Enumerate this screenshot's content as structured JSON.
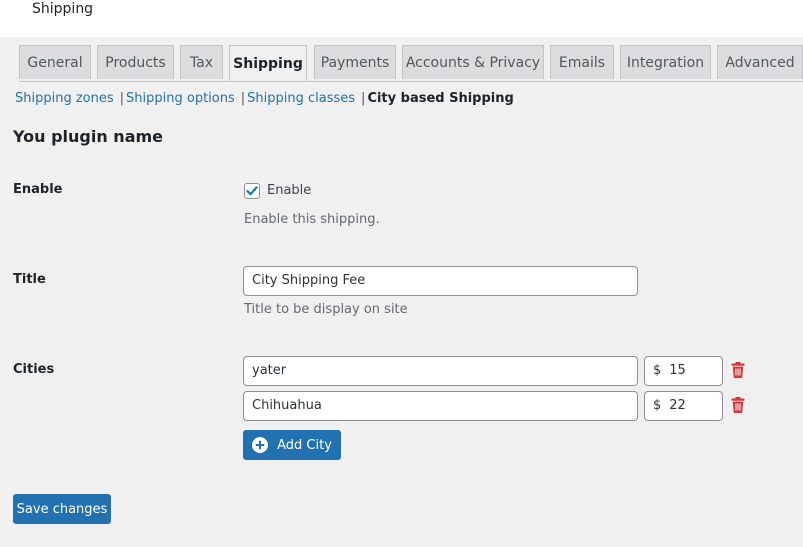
{
  "page": {
    "title": "Shipping"
  },
  "tabs": [
    {
      "label": "General"
    },
    {
      "label": "Products"
    },
    {
      "label": "Tax"
    },
    {
      "label": "Shipping"
    },
    {
      "label": "Payments"
    },
    {
      "label": "Accounts & Privacy"
    },
    {
      "label": "Emails"
    },
    {
      "label": "Integration"
    },
    {
      "label": "Advanced"
    }
  ],
  "subnav": {
    "items": [
      "Shipping zones",
      "Shipping options",
      "Shipping classes"
    ],
    "separator": "|",
    "current": "City based Shipping"
  },
  "section": {
    "title": "You plugin name"
  },
  "enable": {
    "label": "Enable",
    "checkbox_label": "Enable",
    "checked": true,
    "description": "Enable this shipping."
  },
  "title_field": {
    "label": "Title",
    "value": "City Shipping Fee",
    "description": "Title to be display on site"
  },
  "cities": {
    "label": "Cities",
    "currency": "$",
    "rows": [
      {
        "city": "yater",
        "price": "15"
      },
      {
        "city": "Chihuahua",
        "price": "22"
      }
    ],
    "add_label": "Add City"
  },
  "save": {
    "label": "Save changes"
  },
  "colors": {
    "primary": "#2271b1",
    "trash": "#d63638",
    "background": "#f0f0f1",
    "tab_inactive": "#dcdcde"
  },
  "icons": {
    "check": "check-icon",
    "trash": "trash-icon",
    "add": "plus-circle-icon"
  }
}
